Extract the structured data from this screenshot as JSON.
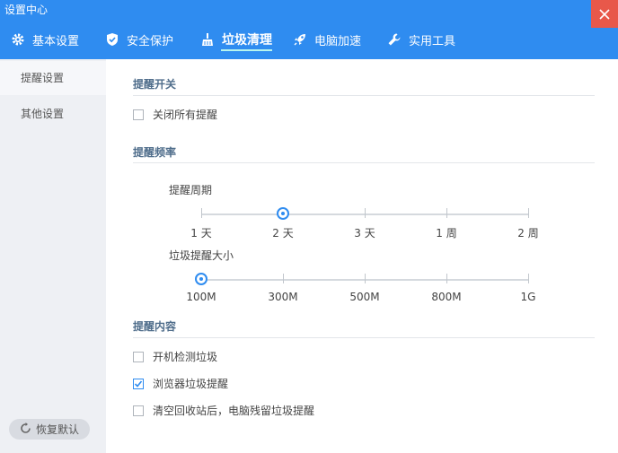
{
  "window": {
    "title": "设置中心"
  },
  "tabs": [
    {
      "label": "基本设置",
      "icon": "gear-icon"
    },
    {
      "label": "安全保护",
      "icon": "shield-icon"
    },
    {
      "label": "垃圾清理",
      "icon": "broom-icon",
      "active": true
    },
    {
      "label": "电脑加速",
      "icon": "rocket-icon"
    },
    {
      "label": "实用工具",
      "icon": "wrench-icon"
    }
  ],
  "sidebar": {
    "items": [
      {
        "label": "提醒设置",
        "active": true
      },
      {
        "label": "其他设置"
      }
    ],
    "reset_label": "恢复默认"
  },
  "sections": {
    "switch": {
      "title": "提醒开关",
      "close_all": {
        "label": "关闭所有提醒",
        "checked": false
      }
    },
    "frequency": {
      "title": "提醒频率",
      "period": {
        "label": "提醒周期",
        "ticks": [
          "1 天",
          "2 天",
          "3 天",
          "1 周",
          "2 周"
        ],
        "selected_index": 1
      },
      "size": {
        "label": "垃圾提醒大小",
        "ticks": [
          "100M",
          "300M",
          "500M",
          "800M",
          "1G"
        ],
        "selected_index": 0
      }
    },
    "content": {
      "title": "提醒内容",
      "items": [
        {
          "label": "开机检测垃圾",
          "checked": false
        },
        {
          "label": "浏览器垃圾提醒",
          "checked": true
        },
        {
          "label": "清空回收站后，电脑残留垃圾提醒",
          "checked": false
        }
      ]
    }
  },
  "colors": {
    "header": "#2f8cf0",
    "close": "#e8584a",
    "accent": "#2f8cf0"
  }
}
